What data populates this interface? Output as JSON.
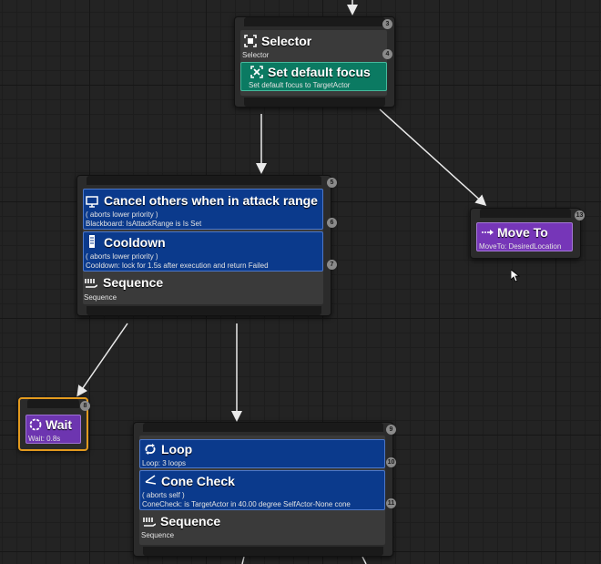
{
  "selector": {
    "title": "Selector",
    "subtitle": "Selector",
    "index": "3",
    "service": {
      "title": "Set default focus",
      "subtitle": "Set default focus to TargetActor",
      "index": "4"
    }
  },
  "sequence1": {
    "index": "5",
    "decorators": [
      {
        "title": "Cancel others when in attack range",
        "line1": "( aborts lower priority )",
        "line2": "Blackboard: IsAttackRange is Is Set",
        "index": "6"
      },
      {
        "title": "Cooldown",
        "line1": "( aborts lower priority )",
        "line2": "Cooldown: lock for 1.5s after execution and return Failed",
        "index": "7"
      }
    ],
    "title": "Sequence",
    "subtitle": "Sequence"
  },
  "moveto": {
    "title": "Move To",
    "subtitle": "MoveTo: DesiredLocation",
    "index": "13"
  },
  "wait": {
    "title": "Wait",
    "subtitle": "Wait: 0.8s",
    "index": "8"
  },
  "sequence2": {
    "index": "9",
    "loop": {
      "title": "Loop",
      "subtitle": "Loop: 3 loops",
      "index": "10"
    },
    "cone": {
      "title": "Cone Check",
      "line1": "( aborts self )",
      "line2": "ConeCheck: is TargetActor in 40.00 degree SelfActor-None cone",
      "index": "11"
    },
    "title": "Sequence",
    "subtitle": "Sequence"
  },
  "colors": {
    "decorator": "#0b3a8c",
    "service": "#0b7a62",
    "task": "#7636b8",
    "wait_border": "#e39a1e",
    "canvas": "#232323"
  }
}
